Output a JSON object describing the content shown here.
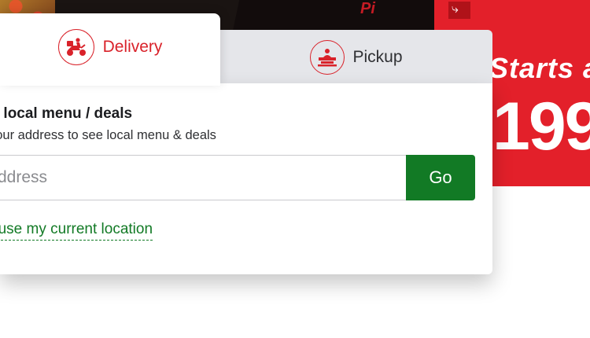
{
  "tabs": {
    "delivery": {
      "label": "Delivery",
      "icon": "scooter-icon"
    },
    "pickup": {
      "label": "Pickup",
      "icon": "pickup-counter-icon"
    }
  },
  "panel": {
    "heading": "ck local menu / deals",
    "subtext": "your address to see local menu & deals",
    "address_input": {
      "value": "",
      "placeholder": "ddress"
    },
    "go_label": "Go",
    "location_link": "r use my current location"
  },
  "promo": {
    "line1": "Starts a",
    "line2": "199"
  },
  "background": {
    "box_logo_text": "Pi"
  },
  "colors": {
    "brand_red": "#d9222a",
    "brand_green": "#127a25",
    "tab_inactive": "#e5e6ea",
    "promo_red": "#e3202a"
  }
}
